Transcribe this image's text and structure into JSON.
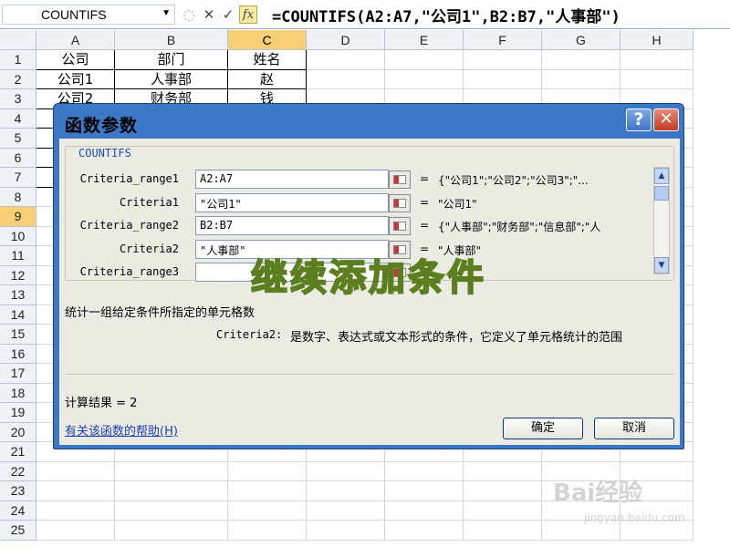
{
  "formula_bar": {
    "name_box": "COUNTIFS",
    "fx_label": "fx",
    "formula": "=COUNTIFS(A2:A7,\"公司1\",B2:B7,\"人事部\")"
  },
  "columns": [
    "A",
    "B",
    "C",
    "D",
    "E",
    "F",
    "G",
    "H"
  ],
  "selected_column": "C",
  "rows": [
    "1",
    "2",
    "3",
    "4",
    "5",
    "6",
    "7",
    "8",
    "9",
    "10",
    "11",
    "12",
    "13",
    "14",
    "15",
    "16",
    "17",
    "18",
    "19",
    "20",
    "21",
    "22",
    "23",
    "24",
    "25"
  ],
  "selected_row": "9",
  "cells": {
    "A1": "公司",
    "B1": "部门",
    "C1": "姓名",
    "A2": "公司1",
    "B2": "人事部",
    "C2": "赵",
    "A3": "公司2",
    "B3": "财务部",
    "C3": "钱"
  },
  "dialog": {
    "title": "函数参数",
    "function_name": "COUNTIFS",
    "args": [
      {
        "label": "Criteria_range1",
        "input": "A2:A7",
        "result": "{\"公司1\";\"公司2\";\"公司3\";\"..."
      },
      {
        "label": "Criteria1",
        "input": "\"公司1\"",
        "result": "\"公司1\""
      },
      {
        "label": "Criteria_range2",
        "input": "B2:B7",
        "result": "{\"人事部\";\"财务部\";\"信息部\";\"人"
      },
      {
        "label": "Criteria2",
        "input": "\"人事部\"",
        "result": "\"人事部\""
      },
      {
        "label": "Criteria_range3",
        "input": "",
        "result": ""
      }
    ],
    "description": "统计一组给定条件所指定的单元格数",
    "arg_desc_label": "Criteria2:",
    "arg_desc": "是数字、表达式或文本形式的条件，它定义了单元格统计的范围",
    "result_label": "计算结果 = 2",
    "help_link": "有关该函数的帮助(H)",
    "ok": "确定",
    "cancel": "取消"
  },
  "overlay": {
    "watermark": "继续添加条件",
    "baidu": "Bai经验",
    "baidu_sub": "jingyan.baidu.com"
  }
}
